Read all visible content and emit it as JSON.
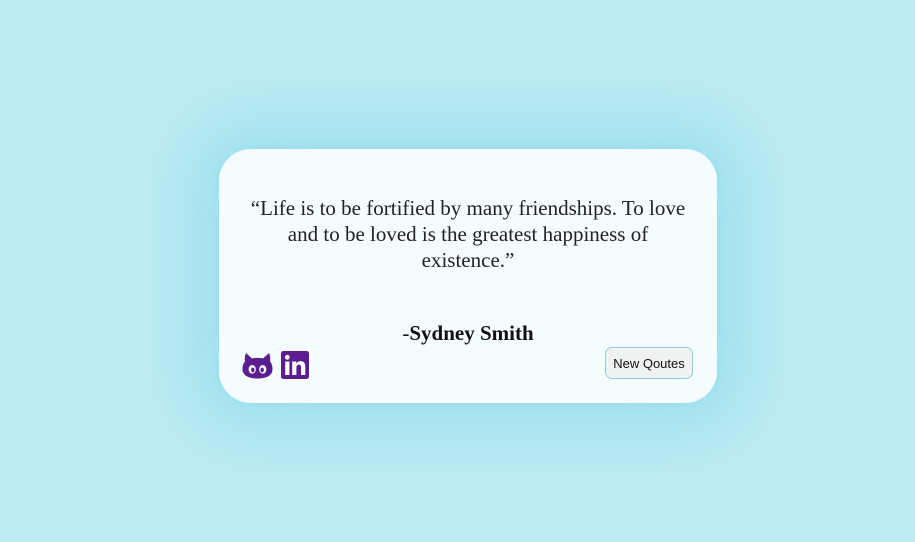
{
  "quote": {
    "text": "“Life is to be fortified by many friendships. To love and to be loved is the greatest happiness of existence.”",
    "author_prefix": "-",
    "author": "Sydney Smith"
  },
  "social": {
    "github_icon": "github-octocat-icon",
    "linkedin_icon": "linkedin-icon",
    "icon_color": "#5b1d8f"
  },
  "button": {
    "label": "New Qoutes"
  },
  "colors": {
    "background": "#bdebf3",
    "card": "#f5fcfd",
    "button_border": "#8fcfe3"
  }
}
